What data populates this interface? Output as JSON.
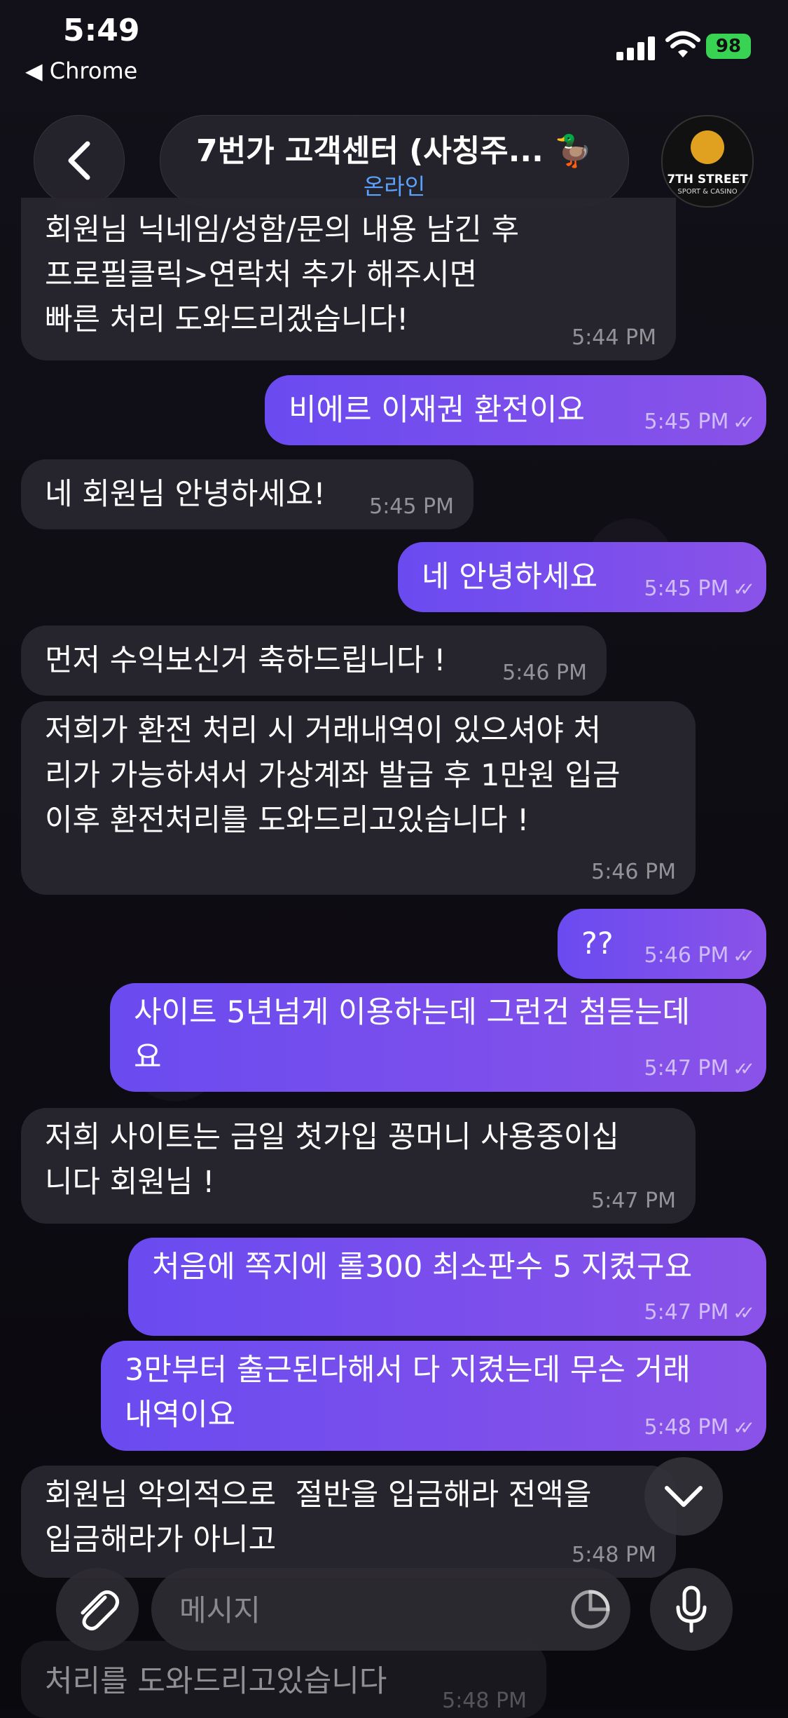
{
  "status_bar": {
    "time": "5:49",
    "back_app": "◀ Chrome",
    "battery": "98"
  },
  "header": {
    "title": "7번가 고객센터 (사칭주... 🦆",
    "status": "온라인"
  },
  "avatar": {
    "name": "7TH STREET",
    "subtitle": "SPORT & CASINO"
  },
  "messages": [
    {
      "dir": "in",
      "text": "회원님 닉네임/성함/문의 내용 남긴 후\n프로필클릭>연락처 추가 해주시면\n빠른 처리 도와드리겠습니다!",
      "time": "5:44 PM"
    },
    {
      "dir": "out",
      "text": "비에르 이재권 환전이요",
      "time": "5:45 PM"
    },
    {
      "dir": "in",
      "text": "네 회원님 안녕하세요!",
      "time": "5:45 PM"
    },
    {
      "dir": "out",
      "text": "네 안녕하세요",
      "time": "5:45 PM"
    },
    {
      "dir": "in",
      "text": "먼저 수익보신거 축하드립니다 !",
      "time": "5:46 PM"
    },
    {
      "dir": "in",
      "text": "저희가 환전 처리 시 거래내역이 있으셔야 처\n리가 가능하셔서 가상계좌 발급 후 1만원 입금\n이후 환전처리를 도와드리고있습니다 !",
      "time": "5:46 PM"
    },
    {
      "dir": "out",
      "text": "??",
      "time": "5:46 PM"
    },
    {
      "dir": "out",
      "text": "사이트 5년넘게 이용하는데 그런건 첨듣는데\n요",
      "time": "5:47 PM"
    },
    {
      "dir": "in",
      "text": "저희 사이트는 금일 첫가입 꽁머니 사용중이십\n니다 회원님 !",
      "time": "5:47 PM"
    },
    {
      "dir": "out",
      "text": "처음에 쪽지에 롤300 최소판수 5 지켰구요",
      "time": "5:47 PM"
    },
    {
      "dir": "out",
      "text": "3만부터 출근된다해서 다 지켰는데 무슨 거래\n내역이요",
      "time": "5:48 PM"
    },
    {
      "dir": "in",
      "text": "회원님 악의적으로  절반을 입금해라 전액을\n입금해라가 아니고",
      "time": "5:48 PM"
    },
    {
      "dir": "in",
      "text": "처리를 도와드리고있습니다",
      "time": "5:48 PM"
    }
  ],
  "composer": {
    "placeholder": "메시지"
  },
  "icons": {
    "back": "chevron-left-icon",
    "attach": "paperclip-icon",
    "sticker": "sticker-icon",
    "mic": "microphone-icon",
    "scroll": "chevron-down-icon"
  },
  "colors": {
    "outgoing": "#7b4ff0",
    "incoming": "#28262e",
    "online": "#5aa2ff",
    "battery": "#39d353"
  }
}
